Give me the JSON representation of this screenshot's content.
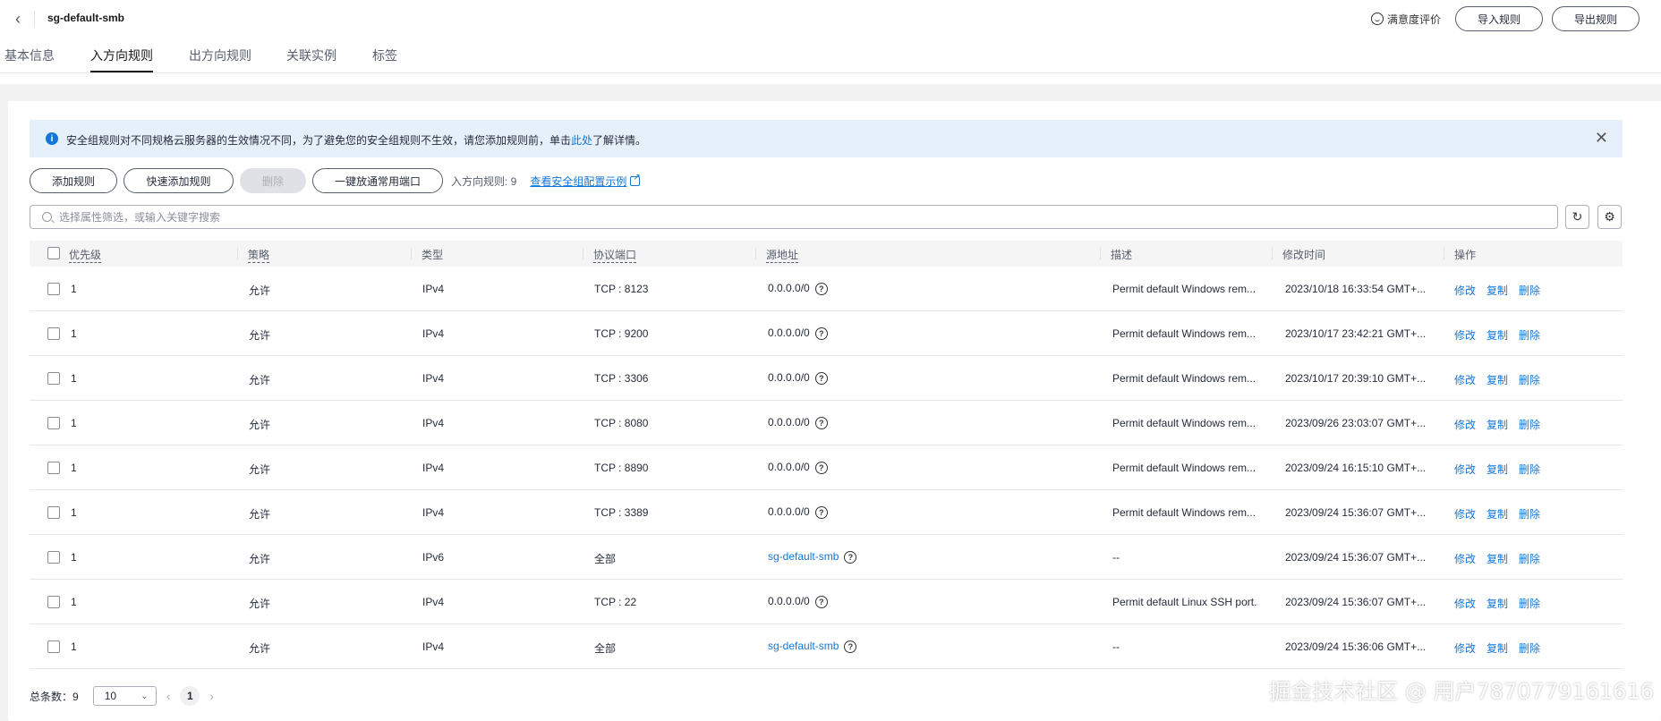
{
  "header": {
    "title": "sg-default-smb",
    "feedback_label": "满意度评价",
    "import_label": "导入规则",
    "export_label": "导出规则"
  },
  "tabs": [
    {
      "label": "基本信息"
    },
    {
      "label": "入方向规则",
      "active": true
    },
    {
      "label": "出方向规则"
    },
    {
      "label": "关联实例"
    },
    {
      "label": "标签"
    }
  ],
  "notice": {
    "text_before": "安全组规则对不同规格云服务器的生效情况不同，为了避免您的安全组规则不生效，请您添加规则前，单击",
    "link": "此处",
    "text_after": "了解详情。"
  },
  "toolbar": {
    "add_label": "添加规则",
    "quick_add_label": "快速添加规则",
    "delete_label": "删除",
    "open_ports_label": "一键放通常用端口",
    "rule_count": "入方向规则: 9",
    "config_example_link": "查看安全组配置示例"
  },
  "search": {
    "placeholder": "选择属性筛选，或输入关键字搜索",
    "value": ""
  },
  "table": {
    "headers": [
      "优先级",
      "策略",
      "类型",
      "协议端口",
      "源地址",
      "描述",
      "修改时间",
      "操作"
    ],
    "rows": [
      {
        "priority": "1",
        "policy": "允许",
        "type": "IPv4",
        "port": "TCP : 8123",
        "source": "0.0.0.0/0",
        "source_is_link": false,
        "desc": "Permit default Windows rem...",
        "time": "2023/10/18 16:33:54 GMT+..."
      },
      {
        "priority": "1",
        "policy": "允许",
        "type": "IPv4",
        "port": "TCP : 9200",
        "source": "0.0.0.0/0",
        "source_is_link": false,
        "desc": "Permit default Windows rem...",
        "time": "2023/10/17 23:42:21 GMT+..."
      },
      {
        "priority": "1",
        "policy": "允许",
        "type": "IPv4",
        "port": "TCP : 3306",
        "source": "0.0.0.0/0",
        "source_is_link": false,
        "desc": "Permit default Windows rem...",
        "time": "2023/10/17 20:39:10 GMT+..."
      },
      {
        "priority": "1",
        "policy": "允许",
        "type": "IPv4",
        "port": "TCP : 8080",
        "source": "0.0.0.0/0",
        "source_is_link": false,
        "desc": "Permit default Windows rem...",
        "time": "2023/09/26 23:03:07 GMT+..."
      },
      {
        "priority": "1",
        "policy": "允许",
        "type": "IPv4",
        "port": "TCP : 8890",
        "source": "0.0.0.0/0",
        "source_is_link": false,
        "desc": "Permit default Windows rem...",
        "time": "2023/09/24 16:15:10 GMT+..."
      },
      {
        "priority": "1",
        "policy": "允许",
        "type": "IPv4",
        "port": "TCP : 3389",
        "source": "0.0.0.0/0",
        "source_is_link": false,
        "desc": "Permit default Windows rem...",
        "time": "2023/09/24 15:36:07 GMT+..."
      },
      {
        "priority": "1",
        "policy": "允许",
        "type": "IPv6",
        "port": "全部",
        "source": "sg-default-smb",
        "source_is_link": true,
        "desc": "--",
        "time": "2023/09/24 15:36:07 GMT+..."
      },
      {
        "priority": "1",
        "policy": "允许",
        "type": "IPv4",
        "port": "TCP : 22",
        "source": "0.0.0.0/0",
        "source_is_link": false,
        "desc": "Permit default Linux SSH port.",
        "time": "2023/09/24 15:36:07 GMT+..."
      },
      {
        "priority": "1",
        "policy": "允许",
        "type": "IPv4",
        "port": "全部",
        "source": "sg-default-smb",
        "source_is_link": true,
        "desc": "--",
        "time": "2023/09/24 15:36:06 GMT+..."
      }
    ],
    "actions": {
      "edit": "修改",
      "copy": "复制",
      "delete": "删除"
    }
  },
  "pagination": {
    "total": "总条数：9",
    "page_size": "10",
    "current_page": "1"
  },
  "watermark": "掘金技术社区 @ 用户7870779161616"
}
